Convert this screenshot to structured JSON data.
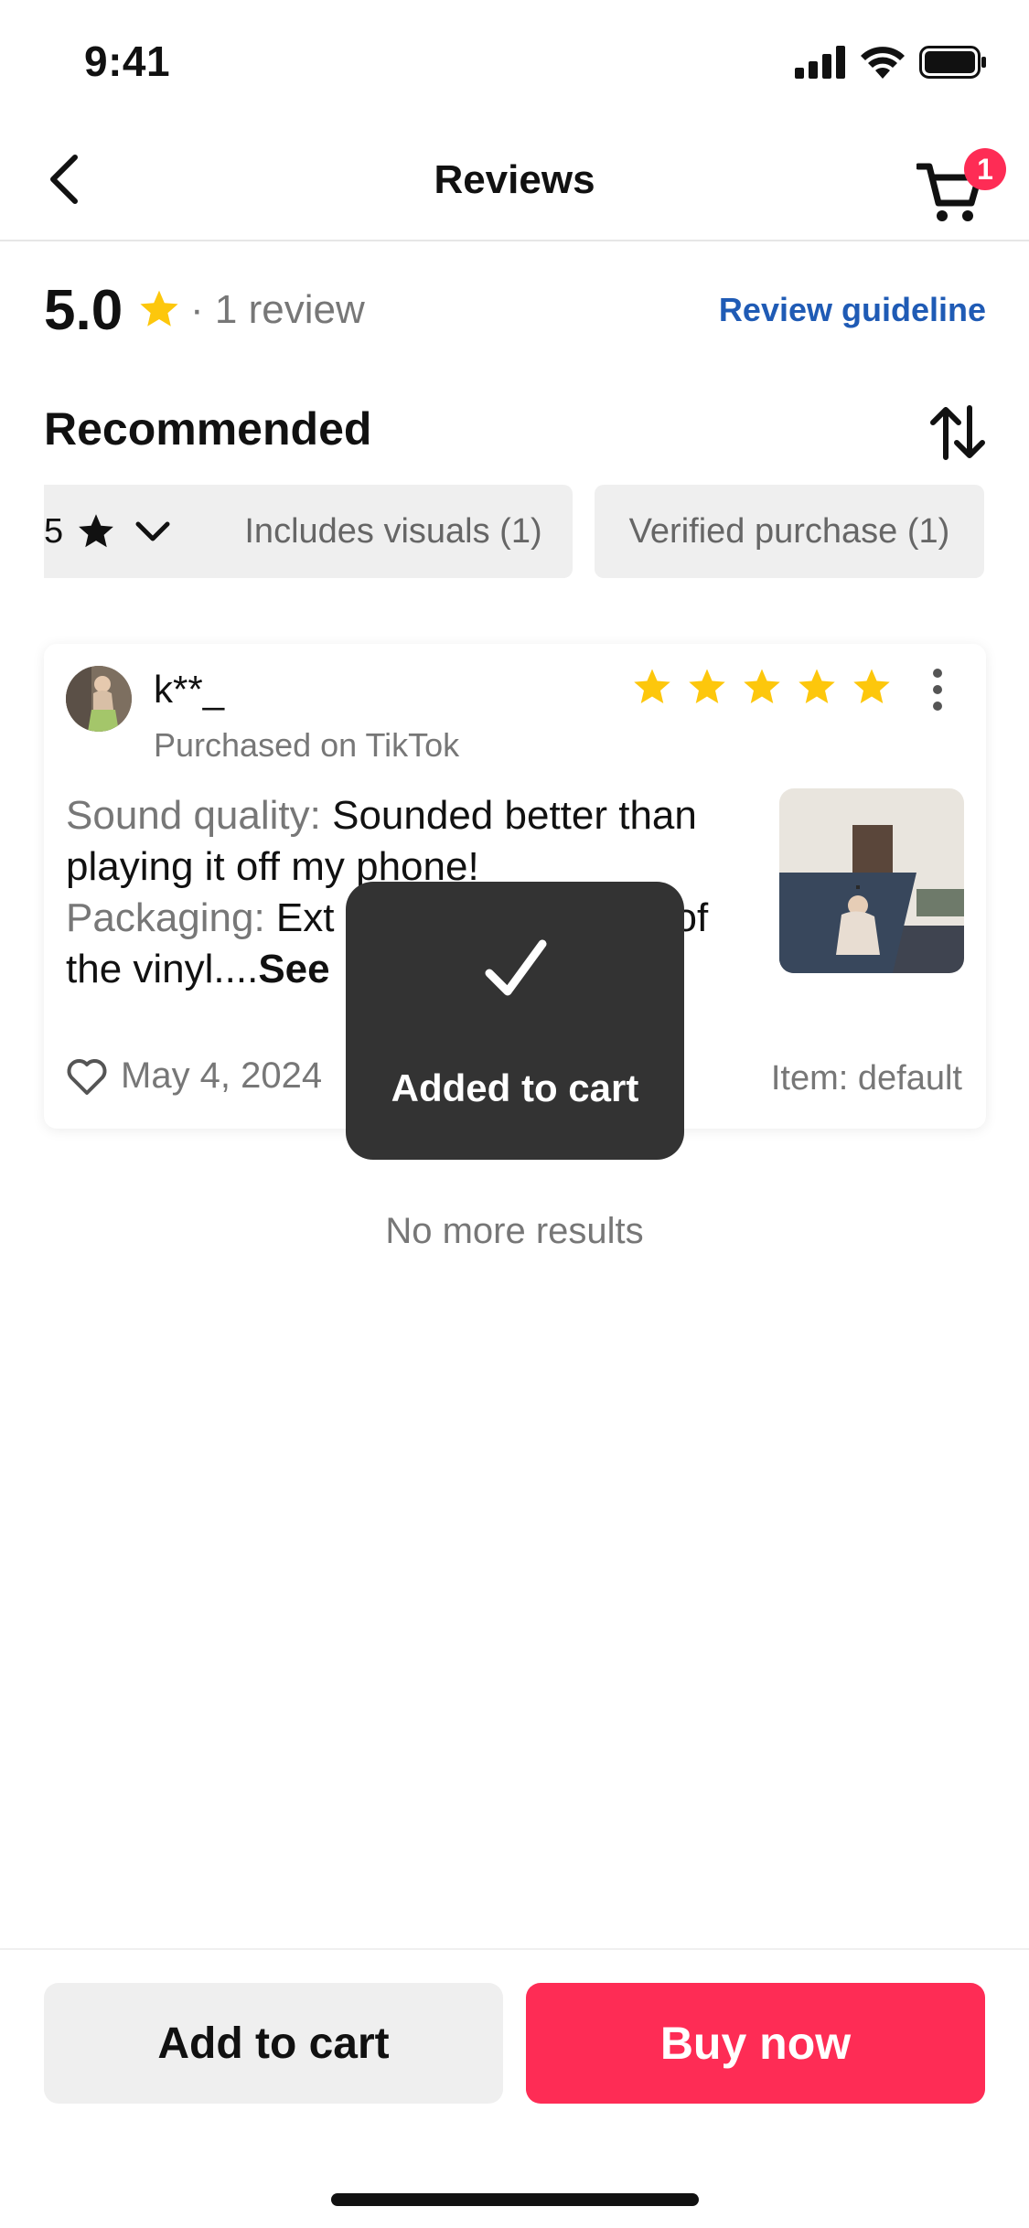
{
  "status_bar": {
    "time": "9:41"
  },
  "nav": {
    "title": "Reviews",
    "cart_count": "1"
  },
  "summary": {
    "rating": "5.0",
    "separator": "·",
    "review_count": "1 review",
    "guideline_link": "Review guideline"
  },
  "section": {
    "title": "Recommended"
  },
  "filters": [
    {
      "label": "5"
    },
    {
      "label": "Includes visuals (1)"
    },
    {
      "label": "Verified purchase (1)"
    }
  ],
  "review": {
    "reviewer": "k**_",
    "purchase_source": "Purchased on TikTok",
    "rating": 5,
    "sound_label": "Sound quality:",
    "sound_text": " Sounded better than playing it off my phone!",
    "packaging_label": "Packaging:",
    "packaging_text": " Ext",
    "packaging_tail": "of the vinyl....",
    "see_more": "See",
    "date": "May 4, 2024",
    "item": "Item: default"
  },
  "toast": {
    "text": "Added to cart"
  },
  "list_footer": "No more results",
  "actions": {
    "add_to_cart": "Add to cart",
    "buy_now": "Buy now"
  },
  "colors": {
    "accent": "#fe2c55",
    "link": "#1f5bb5",
    "star": "#fdc70c",
    "toast_bg": "#333333"
  }
}
